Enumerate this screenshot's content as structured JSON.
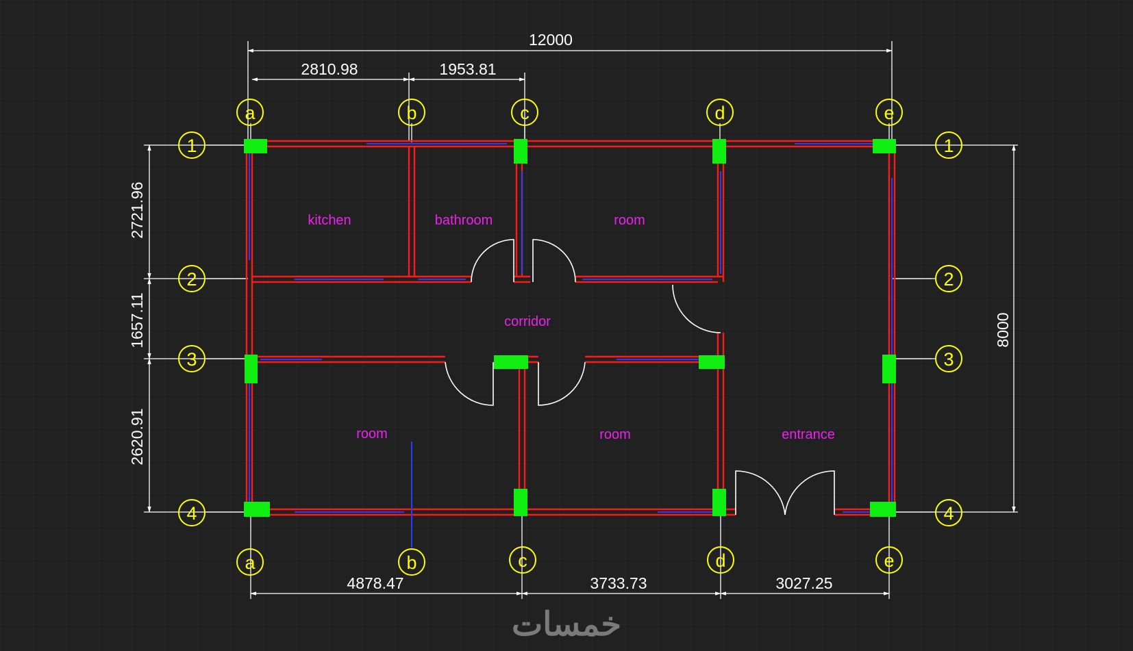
{
  "colors": {
    "background": "#212121",
    "grid": "#2a2a2a",
    "wall": "#ff1a1a",
    "wall_inner": "#2a3cff",
    "column": "#11ee11",
    "dimension": "#ffffff",
    "axis_bubble": "#ffff00",
    "room_label": "#ee22ee",
    "door": "#ffffff",
    "watermark": "#7a7a7a"
  },
  "dimensions": {
    "overall_width": "12000",
    "top_a_b": "2810.98",
    "top_b_c": "1953.81",
    "bottom_a_c": "4878.47",
    "bottom_c_d": "3733.73",
    "bottom_d_e": "3027.25",
    "left_1_2": "2721.96",
    "left_2_3": "1657.11",
    "left_3_4": "2620.91",
    "right_total": "8000"
  },
  "axes": {
    "columns": [
      "a",
      "b",
      "c",
      "d",
      "e"
    ],
    "rows": [
      "1",
      "2",
      "3",
      "4"
    ]
  },
  "rooms": {
    "kitchen": "kitchen",
    "bathroom": "bathroom",
    "room_top": "room",
    "corridor": "corridor",
    "room_bottom_left": "room",
    "room_bottom_mid": "room",
    "entrance": "entrance"
  },
  "watermark": "خمسات"
}
